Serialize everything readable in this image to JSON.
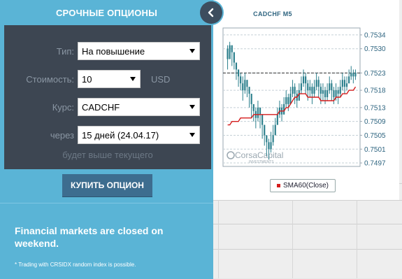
{
  "panel": {
    "title": "СРОЧНЫЕ ОПЦИОНЫ",
    "collapse_icon": "chevron-left-icon",
    "form": {
      "type_label": "Тип:",
      "type_value": "На повышение",
      "cost_label": "Стоимость:",
      "cost_value": "10",
      "cost_currency": "USD",
      "rate_label": "Курс:",
      "rate_value": "CADCHF",
      "expiry_label": "через",
      "expiry_value": "15 дней (24.04.17)",
      "hint": "будет выше текущего"
    },
    "buy_button": "КУПИТЬ ОПЦИОН",
    "closed_title": "Financial markets are closed on weekend.",
    "closed_note": "* Trading with CRSIDX random index is possible.",
    "colors": {
      "panel_blue": "#5ab4d6",
      "form_dark": "#3d4652",
      "button_blue": "#3d6d8f",
      "sma_red": "#d51c1c",
      "candle_teal": "#2b7f8c"
    }
  },
  "chart_data": {
    "type": "candlestick",
    "title": "CADCHF M5",
    "legend": [
      {
        "name": "SMA60(Close)",
        "color": "#d51c1c"
      }
    ],
    "watermark": {
      "name": "CorsaCapital",
      "sub": "INVESTMENTS"
    },
    "ylim": [
      0.7496,
      0.7536
    ],
    "y_ticks": [
      "0.7534",
      "0.7530",
      "0.7523",
      "0.7518",
      "0.7513",
      "0.7509",
      "0.7505",
      "0.7501",
      "0.7497"
    ],
    "y_tick_values": [
      0.7534,
      0.753,
      0.7523,
      0.7518,
      0.7513,
      0.7509,
      0.7505,
      0.7501,
      0.7497
    ],
    "current_price": 0.7523,
    "grid": "dashed-horizontal",
    "series": [
      {
        "name": "CADCHF",
        "close": [
          0.7527,
          0.7531,
          0.7529,
          0.7526,
          0.7524,
          0.7522,
          0.752,
          0.7518,
          0.7521,
          0.7519,
          0.7517,
          0.7514,
          0.7512,
          0.751,
          0.7513,
          0.7511,
          0.7508,
          0.7505,
          0.7503,
          0.7501,
          0.7503,
          0.7505,
          0.7508,
          0.7511,
          0.7513,
          0.7511,
          0.7514,
          0.7516,
          0.7514,
          0.7517,
          0.7519,
          0.7517,
          0.7515,
          0.7518,
          0.752,
          0.7522,
          0.752,
          0.7518,
          0.7519,
          0.7517,
          0.7519,
          0.7521,
          0.7519,
          0.7517,
          0.7518,
          0.7516,
          0.7518,
          0.752,
          0.7518,
          0.7516,
          0.7518,
          0.7517,
          0.7519,
          0.7521,
          0.7519,
          0.752,
          0.7522,
          0.7523,
          0.7522,
          0.7523
        ],
        "high": [
          0.7531,
          0.7532,
          0.7531,
          0.7529,
          0.7526,
          0.7524,
          0.7523,
          0.7522,
          0.7523,
          0.7521,
          0.7519,
          0.7517,
          0.7514,
          0.7513,
          0.7515,
          0.7513,
          0.7511,
          0.7508,
          0.7505,
          0.7504,
          0.7506,
          0.7508,
          0.751,
          0.7513,
          0.7515,
          0.7514,
          0.7516,
          0.7518,
          0.7517,
          0.7519,
          0.7521,
          0.752,
          0.7518,
          0.752,
          0.7522,
          0.7524,
          0.7523,
          0.7521,
          0.7521,
          0.752,
          0.7521,
          0.7523,
          0.7522,
          0.752,
          0.752,
          0.7519,
          0.752,
          0.7522,
          0.7521,
          0.7519,
          0.752,
          0.7519,
          0.7521,
          0.7523,
          0.7522,
          0.7522,
          0.7524,
          0.7525,
          0.7524,
          0.7524
        ],
        "low": [
          0.7524,
          0.7527,
          0.7525,
          0.7524,
          0.7521,
          0.7519,
          0.7518,
          0.7515,
          0.7517,
          0.7516,
          0.7513,
          0.751,
          0.7509,
          0.7507,
          0.7509,
          0.7507,
          0.7504,
          0.7502,
          0.7499,
          0.7498,
          0.75,
          0.7502,
          0.7505,
          0.7508,
          0.751,
          0.7509,
          0.7511,
          0.7513,
          0.7512,
          0.7514,
          0.7516,
          0.7514,
          0.7513,
          0.7515,
          0.7517,
          0.7519,
          0.7517,
          0.7515,
          0.7516,
          0.7514,
          0.7516,
          0.7518,
          0.7516,
          0.7514,
          0.7515,
          0.7514,
          0.7515,
          0.7517,
          0.7515,
          0.7514,
          0.7515,
          0.7514,
          0.7516,
          0.7518,
          0.7517,
          0.7518,
          0.752,
          0.7521,
          0.752,
          0.7521
        ]
      },
      {
        "name": "SMA60(Close)",
        "values": [
          0.7508,
          0.7508,
          0.7509,
          0.7509,
          0.7509,
          0.7509,
          0.751,
          0.751,
          0.751,
          0.751,
          0.751,
          0.751,
          0.7511,
          0.7511,
          0.7511,
          0.7511,
          0.7511,
          0.7511,
          0.7511,
          0.7511,
          0.7511,
          0.7511,
          0.7511,
          0.7511,
          0.7512,
          0.7512,
          0.7512,
          0.7513,
          0.7513,
          0.7514,
          0.7515,
          0.7516,
          0.7516,
          0.7517,
          0.7517,
          0.7517,
          0.7517,
          0.7516,
          0.7516,
          0.7516,
          0.7516,
          0.7516,
          0.7516,
          0.7515,
          0.7515,
          0.7515,
          0.7515,
          0.7515,
          0.7515,
          0.7515,
          0.7516,
          0.7516,
          0.7516,
          0.7517,
          0.7517,
          0.7517,
          0.7518,
          0.7518,
          0.7518,
          0.7519
        ],
        "start_index": 0
      }
    ]
  }
}
